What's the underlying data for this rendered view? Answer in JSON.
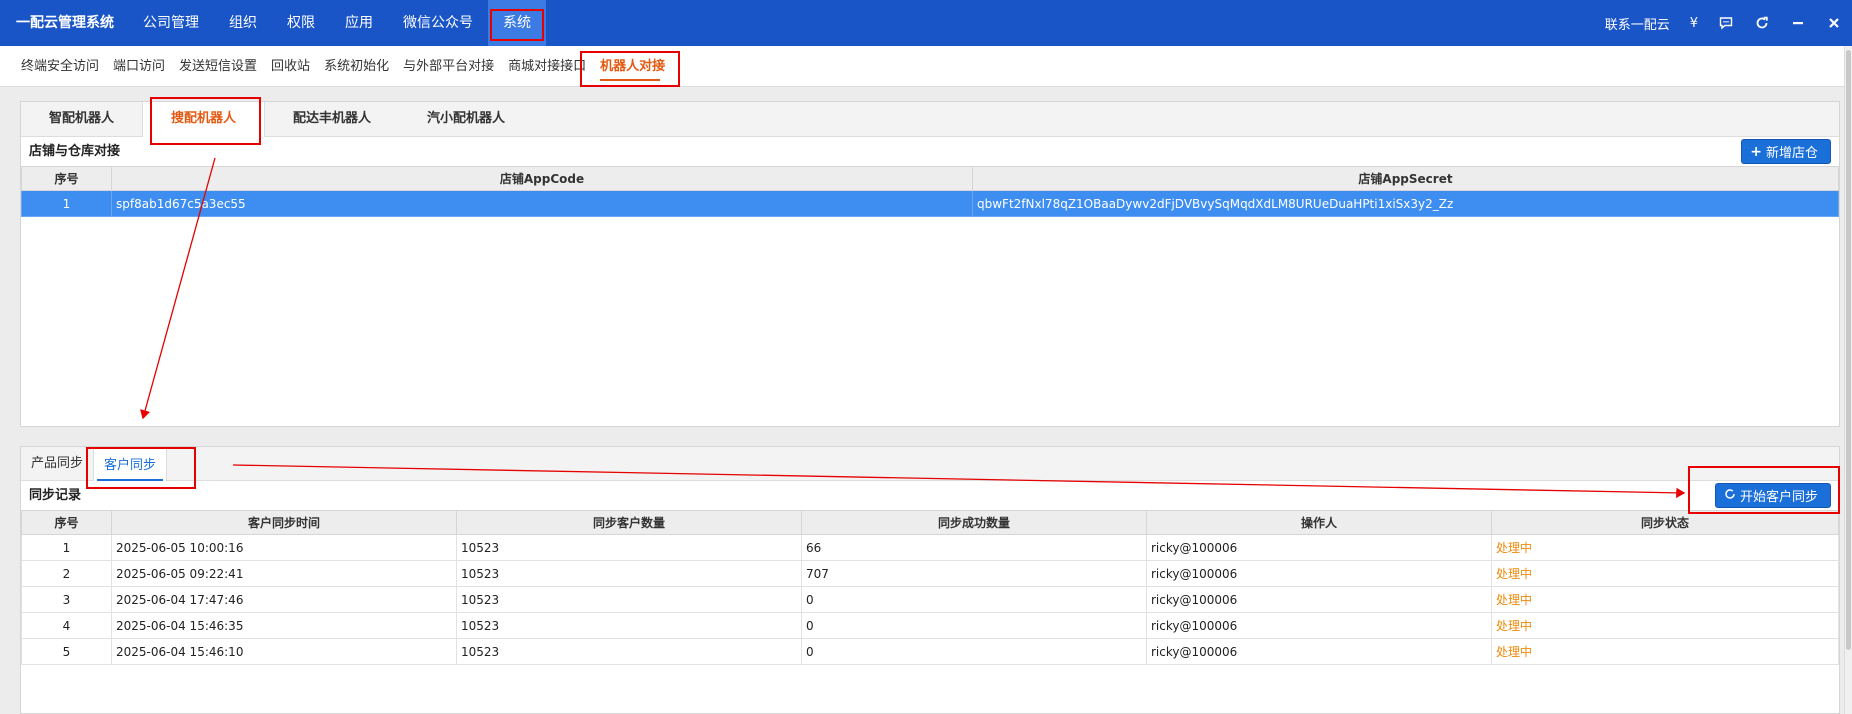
{
  "brand": "一配云管理系统",
  "topnav": [
    "公司管理",
    "组织",
    "权限",
    "应用",
    "微信公众号",
    "系统"
  ],
  "topright": {
    "contact": "联系一配云",
    "currency": "¥"
  },
  "subnav": [
    "终端安全访问",
    "端口访问",
    "发送短信设置",
    "回收站",
    "系统初始化",
    "与外部平台对接",
    "商城对接接口",
    "机器人对接"
  ],
  "robot_tabs": [
    "智配机器人",
    "搜配机器人",
    "配达丰机器人",
    "汽小配机器人"
  ],
  "store_section": {
    "title": "店铺与仓库对接",
    "add_button": "新增店仓",
    "columns": [
      "序号",
      "店铺AppCode",
      "店铺AppSecret"
    ],
    "rows": [
      [
        "1",
        "spf8ab1d67c5a3ec55",
        "qbwFt2fNxl78qZ1OBaaDywv2dFjDVBvySqMqdXdLM8URUeDuaHPti1xiSx3y2_Zz"
      ]
    ]
  },
  "sync_tabs": [
    "产品同步",
    "客户同步"
  ],
  "sync_section": {
    "title": "同步记录",
    "start_button": "开始客户同步",
    "columns": [
      "序号",
      "客户同步时间",
      "同步客户数量",
      "同步成功数量",
      "操作人",
      "同步状态"
    ],
    "rows": [
      [
        "1",
        "2025-06-05 10:00:16",
        "10523",
        "66",
        "ricky@100006",
        "处理中"
      ],
      [
        "2",
        "2025-06-05 09:22:41",
        "10523",
        "707",
        "ricky@100006",
        "处理中"
      ],
      [
        "3",
        "2025-06-04 17:47:46",
        "10523",
        "0",
        "ricky@100006",
        "处理中"
      ],
      [
        "4",
        "2025-06-04 15:46:35",
        "10523",
        "0",
        "ricky@100006",
        "处理中"
      ],
      [
        "5",
        "2025-06-04 15:46:10",
        "10523",
        "0",
        "ricky@100006",
        "处理中"
      ]
    ]
  },
  "colors": {
    "topbar": "#1a55c8",
    "accent_orange": "#e45a12",
    "button_blue": "#1a6fd9",
    "annotation_red": "#e60000",
    "status_orange": "#f0890a"
  },
  "icons": [
    "message-icon",
    "refresh-icon",
    "minimize-icon",
    "close-icon",
    "plus-icon",
    "sync-icon"
  ]
}
